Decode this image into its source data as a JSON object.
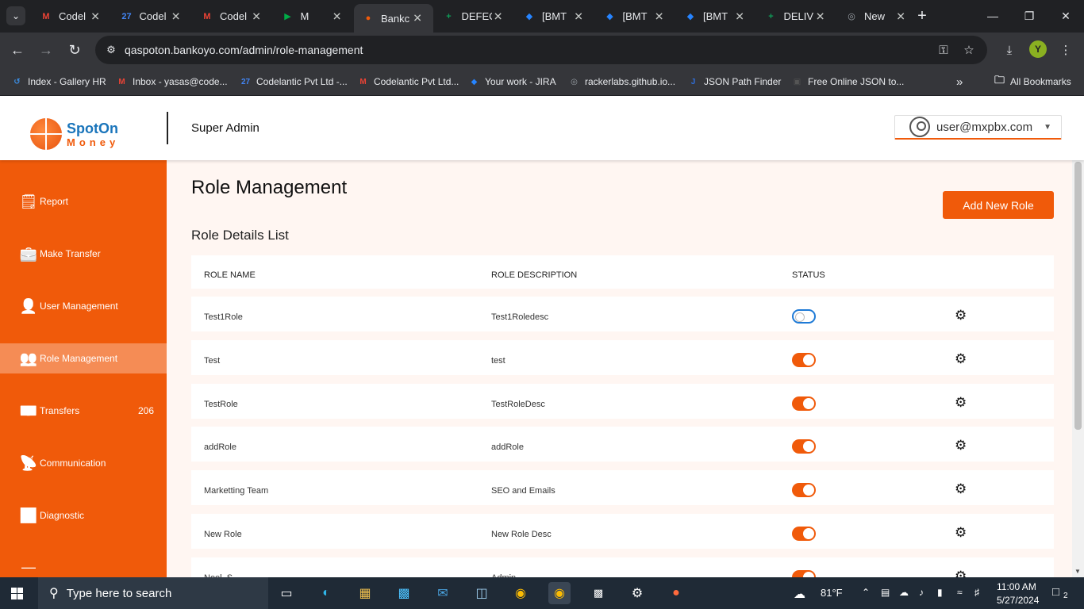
{
  "browser": {
    "tabs": [
      {
        "title": "Codel",
        "icon": "gmail-icon",
        "color": "#ea4335",
        "glyph": "M"
      },
      {
        "title": "Codel",
        "icon": "calendar-icon",
        "color": "#4285f4",
        "glyph": "27"
      },
      {
        "title": "Codel",
        "icon": "gmail-icon",
        "color": "#ea4335",
        "glyph": "M"
      },
      {
        "title": "M",
        "icon": "meet-icon",
        "color": "#00ac47",
        "glyph": "▶"
      },
      {
        "title": "Bankc",
        "icon": "globe-icon",
        "color": "#f05a0a",
        "glyph": "●"
      },
      {
        "title": "DEFEC",
        "icon": "sheets-icon",
        "color": "#0f9d58",
        "glyph": "+"
      },
      {
        "title": "[BMT",
        "icon": "jira-icon",
        "color": "#2684ff",
        "glyph": "◆"
      },
      {
        "title": "[BMT",
        "icon": "jira-icon",
        "color": "#2684ff",
        "glyph": "◆"
      },
      {
        "title": "[BMT",
        "icon": "jira-icon",
        "color": "#2684ff",
        "glyph": "◆"
      },
      {
        "title": "DELIV",
        "icon": "sheets-icon",
        "color": "#0f9d58",
        "glyph": "+"
      },
      {
        "title": "New",
        "icon": "chrome-icon",
        "color": "#9aa0a6",
        "glyph": "◎"
      }
    ],
    "active_tab": 4,
    "url": "qaspoton.bankoyo.com/admin/role-management",
    "profile_initial": "Y",
    "bookmarks": [
      {
        "label": "Index - Gallery HR",
        "icon": "gallery-icon",
        "color": "#3b8fe6",
        "glyph": "↺"
      },
      {
        "label": "Inbox - yasas@code...",
        "icon": "gmail-icon",
        "color": "#ea4335",
        "glyph": "M"
      },
      {
        "label": "Codelantic Pvt Ltd -...",
        "icon": "calendar-icon",
        "color": "#4285f4",
        "glyph": "27"
      },
      {
        "label": "Codelantic Pvt Ltd...",
        "icon": "gmail-icon",
        "color": "#ea4335",
        "glyph": "M"
      },
      {
        "label": "Your work - JIRA",
        "icon": "jira-icon",
        "color": "#2684ff",
        "glyph": "◆"
      },
      {
        "label": "rackerlabs.github.io...",
        "icon": "globe-icon",
        "color": "#9aa0a6",
        "glyph": "◎"
      },
      {
        "label": "JSON Path Finder",
        "icon": "json-icon",
        "color": "#2f6fdc",
        "glyph": "J"
      },
      {
        "label": "Free Online JSON to...",
        "icon": "converter-icon",
        "color": "#555",
        "glyph": "▣"
      }
    ],
    "all_bookmarks": "All Bookmarks"
  },
  "header": {
    "logo_top": "SpotOn",
    "logo_bottom": "Money",
    "title": "Super Admin",
    "user_email": "user@mxpbx.com"
  },
  "sidebar": {
    "items": [
      {
        "label": "Report",
        "icon": "report-icon",
        "glyph": "🗒",
        "count": ""
      },
      {
        "label": "Make Transfer",
        "icon": "transfer-icon",
        "glyph": "💼",
        "count": ""
      },
      {
        "label": "User Management",
        "icon": "add-user-icon",
        "glyph": "👤",
        "count": ""
      },
      {
        "label": "Role Management",
        "icon": "users-icon",
        "glyph": "👥",
        "count": ""
      },
      {
        "label": "Transfers",
        "icon": "money-icon",
        "glyph": "💵",
        "count": "206"
      },
      {
        "label": "Communication",
        "icon": "communication-icon",
        "glyph": "📡",
        "count": ""
      },
      {
        "label": "Diagnostic",
        "icon": "diagnostic-icon",
        "glyph": "📈",
        "count": ""
      }
    ],
    "active_index": 3
  },
  "main": {
    "title": "Role Management",
    "add_button": "Add New Role",
    "list_title": "Role Details List",
    "columns": [
      "ROLE NAME",
      "ROLE DESCRIPTION",
      "STATUS"
    ],
    "rows": [
      {
        "name": "Test1Role",
        "description": "Test1Roledesc",
        "status": false
      },
      {
        "name": "Test",
        "description": "test",
        "status": true
      },
      {
        "name": "TestRole",
        "description": "TestRoleDesc",
        "status": true
      },
      {
        "name": "addRole",
        "description": "addRole",
        "status": true
      },
      {
        "name": "Marketting Team",
        "description": "SEO and Emails",
        "status": true
      },
      {
        "name": "New Role",
        "description": "New Role Desc",
        "status": true
      },
      {
        "name": "Neel_S",
        "description": "Admin",
        "status": true
      }
    ]
  },
  "taskbar": {
    "search_placeholder": "Type here to search",
    "weather": "81°F",
    "time": "11:00 AM",
    "date": "5/27/2024",
    "notification_count": "2"
  }
}
